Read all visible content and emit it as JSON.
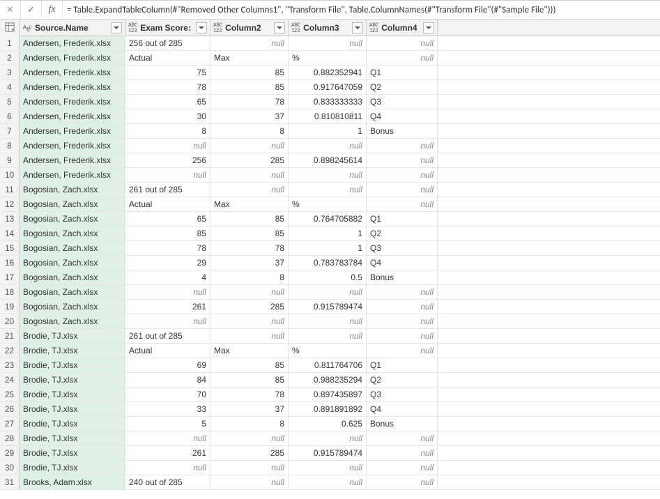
{
  "formula_bar": {
    "cancel_glyph": "✕",
    "confirm_glyph": "✓",
    "fx_label": "fx",
    "formula": "= Table.ExpandTableColumn(#\"Removed Other Columns1\", \"Transform File\", Table.ColumnNames(#\"Transform File\"(#\"Sample File\")))"
  },
  "headers": {
    "source_name": "Source.Name",
    "exam_score": "Exam Score:",
    "column2": "Column2",
    "column3": "Column3",
    "column4": "Column4"
  },
  "null_text": "null",
  "chart_data": {
    "type": "table",
    "columns": [
      "Source.Name",
      "Exam Score:",
      "Column2",
      "Column3",
      "Column4"
    ],
    "rows": [
      [
        "Andersen, Frederik.xlsx",
        "256 out of 285",
        null,
        null,
        null
      ],
      [
        "Andersen, Frederik.xlsx",
        "Actual",
        "Max",
        "%",
        null
      ],
      [
        "Andersen, Frederik.xlsx",
        75,
        85,
        0.882352941,
        "Q1"
      ],
      [
        "Andersen, Frederik.xlsx",
        78,
        85,
        0.917647059,
        "Q2"
      ],
      [
        "Andersen, Frederik.xlsx",
        65,
        78,
        0.833333333,
        "Q3"
      ],
      [
        "Andersen, Frederik.xlsx",
        30,
        37,
        0.810810811,
        "Q4"
      ],
      [
        "Andersen, Frederik.xlsx",
        8,
        8,
        1,
        "Bonus"
      ],
      [
        "Andersen, Frederik.xlsx",
        null,
        null,
        null,
        null
      ],
      [
        "Andersen, Frederik.xlsx",
        256,
        285,
        0.898245614,
        null
      ],
      [
        "Andersen, Frederik.xlsx",
        null,
        null,
        null,
        null
      ],
      [
        "Bogosian, Zach.xlsx",
        "261 out of 285",
        null,
        null,
        null
      ],
      [
        "Bogosian, Zach.xlsx",
        "Actual",
        "Max",
        "%",
        null
      ],
      [
        "Bogosian, Zach.xlsx",
        65,
        85,
        0.764705882,
        "Q1"
      ],
      [
        "Bogosian, Zach.xlsx",
        85,
        85,
        1,
        "Q2"
      ],
      [
        "Bogosian, Zach.xlsx",
        78,
        78,
        1,
        "Q3"
      ],
      [
        "Bogosian, Zach.xlsx",
        29,
        37,
        0.783783784,
        "Q4"
      ],
      [
        "Bogosian, Zach.xlsx",
        4,
        8,
        0.5,
        "Bonus"
      ],
      [
        "Bogosian, Zach.xlsx",
        null,
        null,
        null,
        null
      ],
      [
        "Bogosian, Zach.xlsx",
        261,
        285,
        0.915789474,
        null
      ],
      [
        "Bogosian, Zach.xlsx",
        null,
        null,
        null,
        null
      ],
      [
        "Brodie, TJ.xlsx",
        "261 out of 285",
        null,
        null,
        null
      ],
      [
        "Brodie, TJ.xlsx",
        "Actual",
        "Max",
        "%",
        null
      ],
      [
        "Brodie, TJ.xlsx",
        69,
        85,
        0.811764706,
        "Q1"
      ],
      [
        "Brodie, TJ.xlsx",
        84,
        85,
        0.988235294,
        "Q2"
      ],
      [
        "Brodie, TJ.xlsx",
        70,
        78,
        0.897435897,
        "Q3"
      ],
      [
        "Brodie, TJ.xlsx",
        33,
        37,
        0.891891892,
        "Q4"
      ],
      [
        "Brodie, TJ.xlsx",
        5,
        8,
        0.625,
        "Bonus"
      ],
      [
        "Brodie, TJ.xlsx",
        null,
        null,
        null,
        null
      ],
      [
        "Brodie, TJ.xlsx",
        261,
        285,
        0.915789474,
        null
      ],
      [
        "Brodie, TJ.xlsx",
        null,
        null,
        null,
        null
      ],
      [
        "Brooks, Adam.xlsx",
        "240 out of 285",
        null,
        null,
        null
      ]
    ]
  }
}
